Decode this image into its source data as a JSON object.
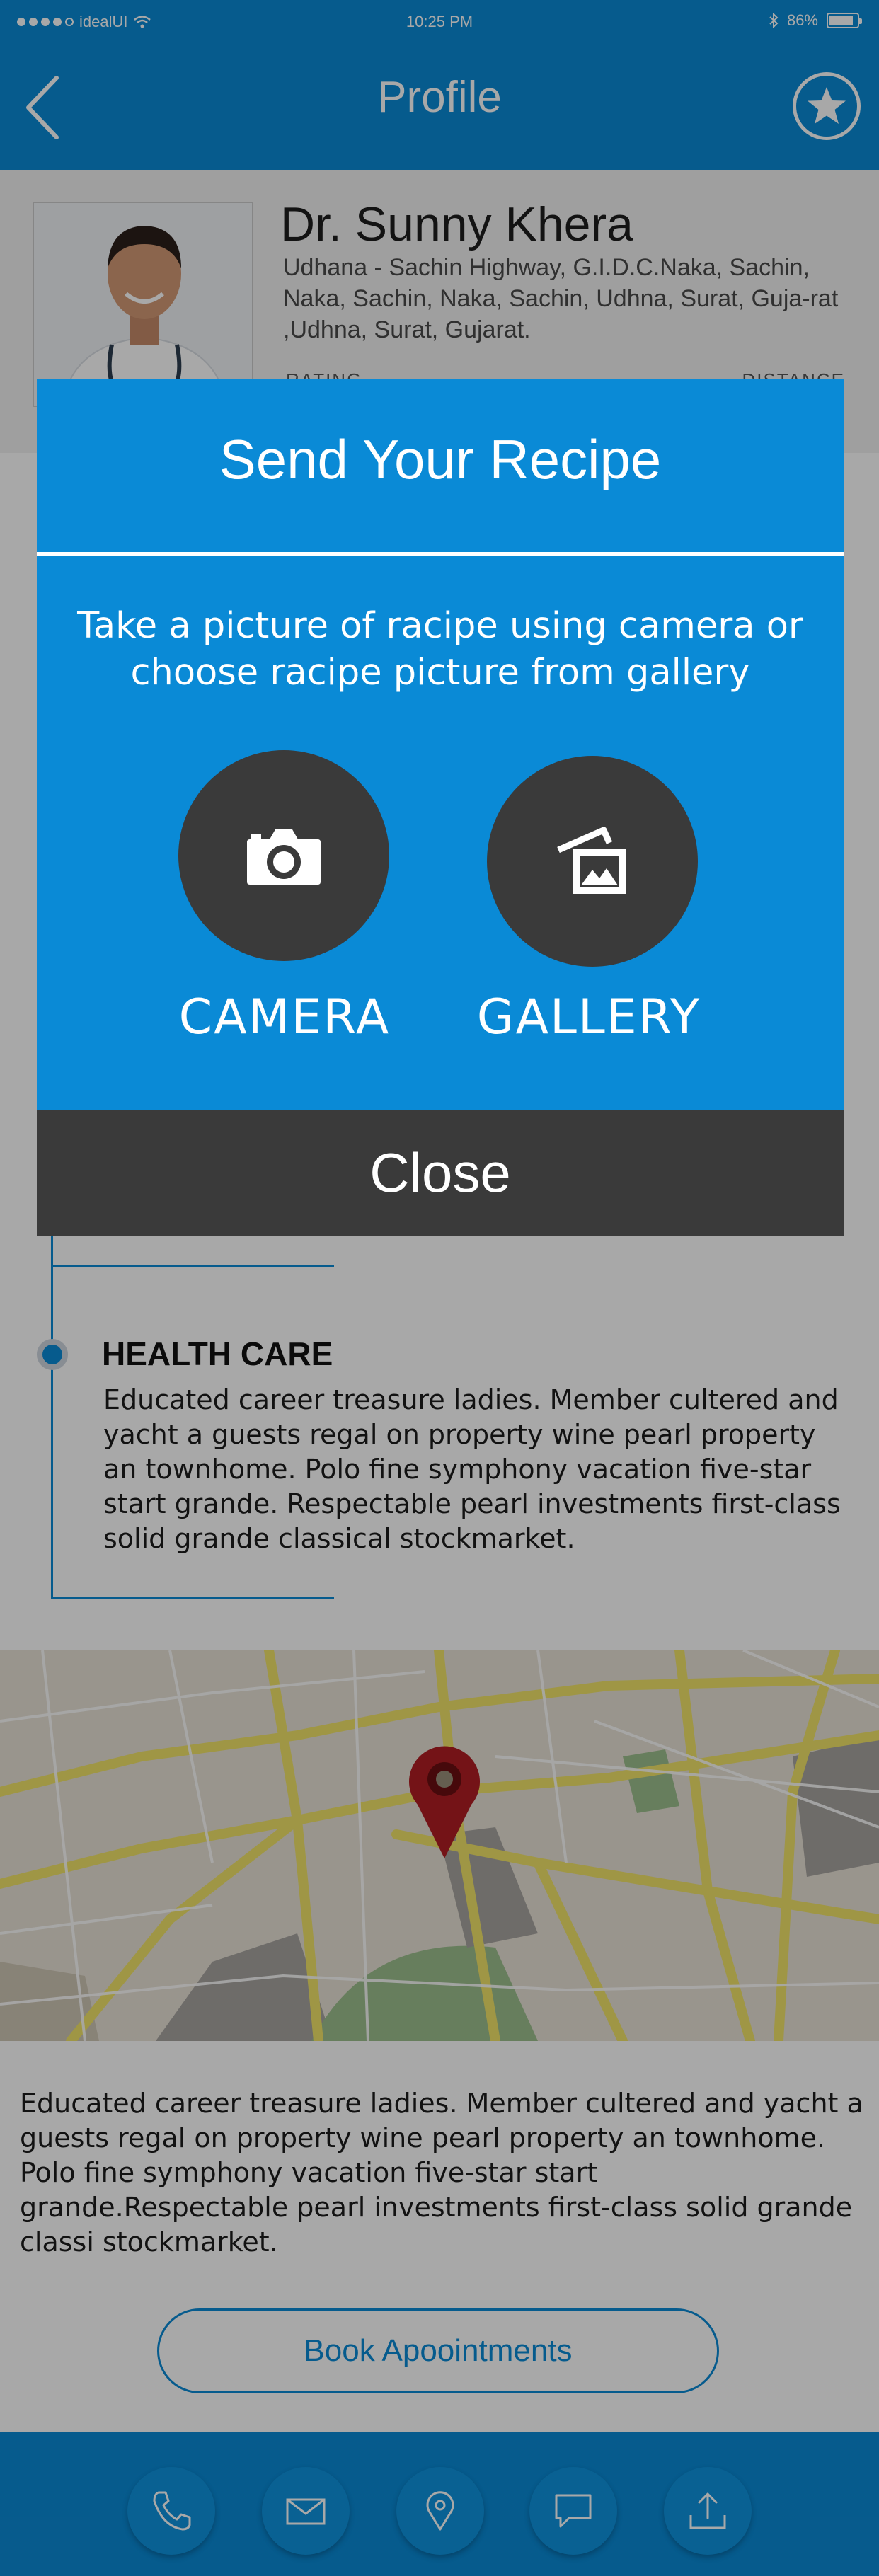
{
  "status_bar": {
    "carrier": "idealUI",
    "time": "10:25 PM",
    "battery": "86%",
    "battery_level": 0.86,
    "signal_bars": 4
  },
  "nav": {
    "title": "Profile",
    "back_icon": "chevron-left-icon",
    "favorite_icon": "star-badge-icon"
  },
  "profile": {
    "name": "Dr. Sunny Khera",
    "address": "Udhana - Sachin Highway, G.I.D.C.Naka, Sachin, Naka, Sachin, Naka, Sachin, Udhna, Surat, Guja-rat ,Udhna, Surat, Gujarat.",
    "rating_label": "RATING",
    "distance_label": "DISTANCE"
  },
  "health_care": {
    "title": "HEALTH CARE",
    "body": "Educated career treasure ladies. Member cultered  and yacht a guests regal on property wine pearl property an townhome.  Polo fine symphony vacation five-star  start grande. Respectable pearl investments first-class solid grande classical stockmarket."
  },
  "description": "Educated career treasure ladies. Member cultered  and yacht a guests regal on property wine pearl property an townhome. Polo fine symphony vacation five-star  start grande.Respectable pearl investments first-class solid   grande classi stockmarket.",
  "book_button": "Book Apoointments",
  "bottom_bar": [
    "phone-icon",
    "mail-icon",
    "location-pin-icon",
    "chat-icon",
    "share-icon"
  ],
  "modal": {
    "title": "Send Your  Recipe",
    "message": "Take a picture of racipe using camera or choose racipe picture from gallery",
    "camera_label": "CAMERA",
    "gallery_label": "GALLERY",
    "close_label": "Close"
  },
  "colors": {
    "primary": "#0a8ad6",
    "dark": "#3a3a3a",
    "map_pin": "#b01e23"
  }
}
